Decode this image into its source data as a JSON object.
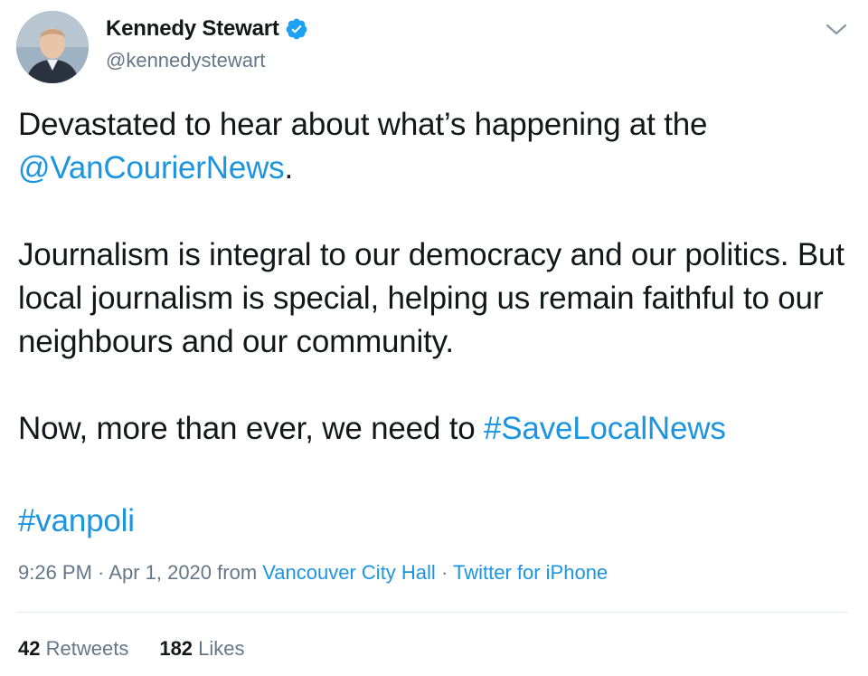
{
  "author": {
    "display_name": "Kennedy Stewart",
    "handle": "@kennedystewart",
    "verified": true,
    "verified_icon": "verified-badge-icon",
    "avatar": "profile-photo"
  },
  "menu": {
    "icon": "chevron-down-icon"
  },
  "tweet": {
    "line1_text": "Devastated to hear about what’s happening at the ",
    "mention": "@VanCourierNews",
    "line1_end": ".",
    "para2": "Journalism is integral to our democracy and our politics. But local journalism is special, helping us remain faithful to our neighbours and our community.",
    "para3_text": "Now, more than ever, we need to ",
    "hashtag1": "#SaveLocalNews",
    "hashtag2": "#vanpoli"
  },
  "meta": {
    "time": "9:26 PM",
    "sep1": " · ",
    "date": "Apr 1, 2020",
    "from": " from ",
    "location": "Vancouver City Hall",
    "sep2": " · ",
    "source": "Twitter for iPhone"
  },
  "stats": {
    "retweets_count": "42",
    "retweets_label": "Retweets",
    "likes_count": "182",
    "likes_label": "Likes"
  },
  "colors": {
    "link": "#1b95e0",
    "text": "#14171a",
    "muted": "#657786",
    "divider": "#e1e8ed",
    "verified": "#1da1f2"
  }
}
